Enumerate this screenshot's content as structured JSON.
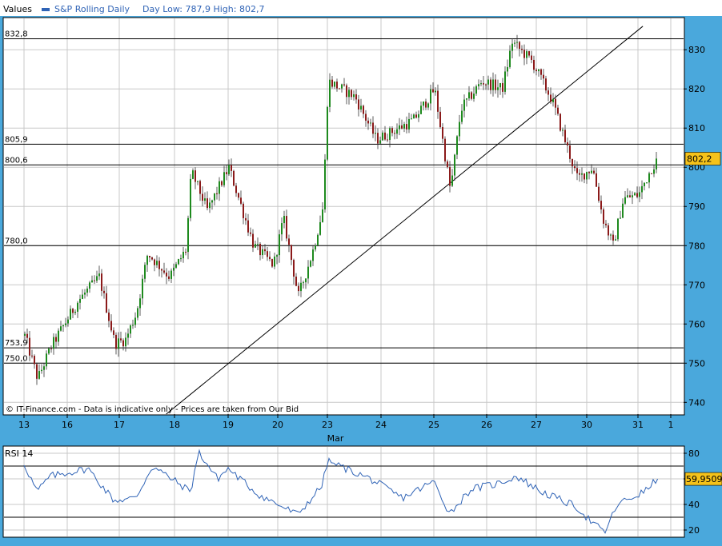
{
  "header": {
    "values_label": "Values",
    "series_label": "S&P Rolling Daily",
    "day_range": "Day Low: 787,9 High: 802,7"
  },
  "watermark": "© IT-Finance.com - Data is indicative only - Prices are taken from Our Bid",
  "last_price_badge": "802,2",
  "rsi_label": "RSI 14",
  "rsi_value_badge": "59,9509",
  "colors": {
    "frame": "#4aa8dc",
    "up_candle": "#1e8a1e",
    "down_candle": "#8b1a1a",
    "rsi_line": "#2f63b6",
    "badge": "#f5c21a",
    "grid": "#c8c8c8"
  },
  "chart_data": [
    {
      "type": "candlestick",
      "ylim": [
        737,
        838
      ],
      "y_ticks": [
        740,
        750,
        760,
        770,
        780,
        790,
        800,
        810,
        820,
        830
      ],
      "x_ticks": [
        "13",
        "16",
        "17",
        "18",
        "19",
        "20",
        "23",
        "24",
        "25",
        "26",
        "27",
        "30",
        "31",
        "1"
      ],
      "x_month_label": "Mar",
      "grid": true,
      "levels": [
        {
          "label": "832,8",
          "value": 832.8
        },
        {
          "label": "805,9",
          "value": 805.9
        },
        {
          "label": "800,6",
          "value": 800.6
        },
        {
          "label": "780,0",
          "value": 780.0
        },
        {
          "label": "753,9",
          "value": 753.9
        },
        {
          "label": "750,0",
          "value": 750.0
        }
      ],
      "trendline": {
        "from": {
          "day": "17",
          "value": 737
        },
        "to": {
          "day": "31",
          "value": 836
        }
      },
      "close_path": [
        {
          "day": "13",
          "t": 0.0,
          "v": 757
        },
        {
          "day": "13",
          "t": 0.3,
          "v": 746
        },
        {
          "day": "13",
          "t": 0.6,
          "v": 754
        },
        {
          "day": "16",
          "t": 0.2,
          "v": 766
        },
        {
          "day": "16",
          "t": 0.6,
          "v": 772
        },
        {
          "day": "16",
          "t": 0.9,
          "v": 755
        },
        {
          "day": "17",
          "t": 0.1,
          "v": 756
        },
        {
          "day": "17",
          "t": 0.3,
          "v": 763
        },
        {
          "day": "17",
          "t": 0.5,
          "v": 778
        },
        {
          "day": "17",
          "t": 0.9,
          "v": 772
        },
        {
          "day": "18",
          "t": 0.2,
          "v": 779
        },
        {
          "day": "18",
          "t": 0.3,
          "v": 799
        },
        {
          "day": "18",
          "t": 0.6,
          "v": 789
        },
        {
          "day": "19",
          "t": 0.0,
          "v": 800
        },
        {
          "day": "19",
          "t": 0.5,
          "v": 780
        },
        {
          "day": "19",
          "t": 0.9,
          "v": 775
        },
        {
          "day": "20",
          "t": 0.1,
          "v": 787
        },
        {
          "day": "20",
          "t": 0.4,
          "v": 767
        },
        {
          "day": "20",
          "t": 0.7,
          "v": 779
        },
        {
          "day": "20",
          "t": 0.9,
          "v": 790
        },
        {
          "day": "23",
          "t": 0.0,
          "v": 822
        },
        {
          "day": "23",
          "t": 0.5,
          "v": 818
        },
        {
          "day": "23",
          "t": 0.9,
          "v": 807
        },
        {
          "day": "24",
          "t": 0.6,
          "v": 812
        },
        {
          "day": "25",
          "t": 0.0,
          "v": 820
        },
        {
          "day": "25",
          "t": 0.3,
          "v": 794
        },
        {
          "day": "25",
          "t": 0.5,
          "v": 815
        },
        {
          "day": "25",
          "t": 0.9,
          "v": 822
        },
        {
          "day": "26",
          "t": 0.3,
          "v": 820
        },
        {
          "day": "26",
          "t": 0.5,
          "v": 832
        },
        {
          "day": "26",
          "t": 0.9,
          "v": 827
        },
        {
          "day": "27",
          "t": 0.3,
          "v": 817
        },
        {
          "day": "27",
          "t": 0.8,
          "v": 797
        },
        {
          "day": "30",
          "t": 0.1,
          "v": 800
        },
        {
          "day": "30",
          "t": 0.3,
          "v": 787
        },
        {
          "day": "30",
          "t": 0.5,
          "v": 780
        },
        {
          "day": "30",
          "t": 0.7,
          "v": 792
        },
        {
          "day": "31",
          "t": 0.0,
          "v": 793
        },
        {
          "day": "31",
          "t": 0.4,
          "v": 800
        },
        {
          "day": "31",
          "t": 0.6,
          "v": 802.2
        }
      ]
    },
    {
      "type": "line",
      "ylim": [
        15,
        85
      ],
      "y_ticks": [
        20,
        40,
        60,
        80
      ],
      "levels": [
        70,
        30
      ],
      "path": [
        {
          "day": "13",
          "t": 0.0,
          "v": 72
        },
        {
          "day": "13",
          "t": 0.3,
          "v": 50
        },
        {
          "day": "13",
          "t": 0.6,
          "v": 62
        },
        {
          "day": "16",
          "t": 0.4,
          "v": 68
        },
        {
          "day": "16",
          "t": 0.9,
          "v": 43
        },
        {
          "day": "17",
          "t": 0.3,
          "v": 45
        },
        {
          "day": "17",
          "t": 0.6,
          "v": 70
        },
        {
          "day": "18",
          "t": 0.3,
          "v": 50
        },
        {
          "day": "18",
          "t": 0.45,
          "v": 81
        },
        {
          "day": "18",
          "t": 0.8,
          "v": 60
        },
        {
          "day": "19",
          "t": 0.0,
          "v": 68
        },
        {
          "day": "19",
          "t": 0.6,
          "v": 48
        },
        {
          "day": "20",
          "t": 0.0,
          "v": 40
        },
        {
          "day": "20",
          "t": 0.4,
          "v": 32
        },
        {
          "day": "20",
          "t": 0.9,
          "v": 55
        },
        {
          "day": "23",
          "t": 0.0,
          "v": 74
        },
        {
          "day": "23",
          "t": 0.8,
          "v": 60
        },
        {
          "day": "24",
          "t": 0.4,
          "v": 45
        },
        {
          "day": "25",
          "t": 0.0,
          "v": 58
        },
        {
          "day": "25",
          "t": 0.3,
          "v": 33
        },
        {
          "day": "25",
          "t": 0.7,
          "v": 52
        },
        {
          "day": "26",
          "t": 0.2,
          "v": 56
        },
        {
          "day": "26",
          "t": 0.6,
          "v": 62
        },
        {
          "day": "27",
          "t": 0.1,
          "v": 50
        },
        {
          "day": "27",
          "t": 0.8,
          "v": 38
        },
        {
          "day": "30",
          "t": 0.1,
          "v": 26
        },
        {
          "day": "30",
          "t": 0.35,
          "v": 18
        },
        {
          "day": "30",
          "t": 0.6,
          "v": 40
        },
        {
          "day": "31",
          "t": 0.2,
          "v": 50
        },
        {
          "day": "31",
          "t": 0.6,
          "v": 59.95
        }
      ]
    }
  ]
}
